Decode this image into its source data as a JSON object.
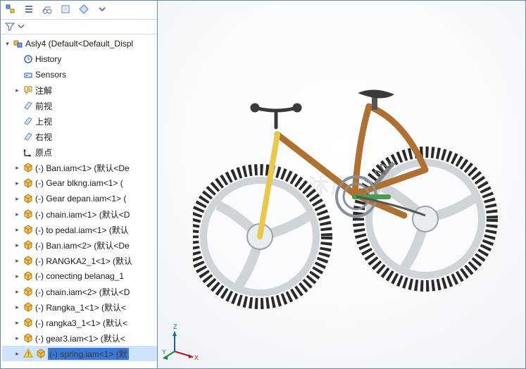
{
  "toolbar": {
    "buttons": [
      "assembly-icon",
      "list-icon",
      "motion-icon",
      "config-icon",
      "display-icon",
      "hide-icon"
    ]
  },
  "filter": {
    "tooltip": "Filter"
  },
  "tree": {
    "root": {
      "label": "Asly4  (Default<Default_Displ",
      "expand": "▾"
    },
    "items": [
      {
        "icon": "history-icon",
        "label": "History",
        "expand": ""
      },
      {
        "icon": "sensors-icon",
        "label": "Sensors",
        "expand": ""
      },
      {
        "icon": "annot-icon",
        "label": "注解",
        "expand": "▸"
      },
      {
        "icon": "plane-icon",
        "label": "前视",
        "expand": ""
      },
      {
        "icon": "plane-icon",
        "label": "上视",
        "expand": ""
      },
      {
        "icon": "plane-icon",
        "label": "右视",
        "expand": ""
      },
      {
        "icon": "origin-icon",
        "label": "原点",
        "expand": ""
      },
      {
        "icon": "part-icon",
        "label": "(-) Ban.iam<1> (默认<De",
        "expand": "▸"
      },
      {
        "icon": "part-icon",
        "label": "(-) Gear blkng.iam<1> (",
        "expand": "▸"
      },
      {
        "icon": "part-icon",
        "label": "(-) Gear depan.iam<1> (",
        "expand": "▸"
      },
      {
        "icon": "part-icon",
        "label": "(-) chain.iam<1> (默认<D",
        "expand": "▸"
      },
      {
        "icon": "part-icon",
        "label": "(-) to pedal.iam<1> (默认",
        "expand": "▸"
      },
      {
        "icon": "part-icon",
        "label": "(-) Ban.iam<2> (默认<De",
        "expand": "▸"
      },
      {
        "icon": "part-icon",
        "label": "(-) RANGKA2_1<1> (默认",
        "expand": "▸"
      },
      {
        "icon": "part-icon",
        "label": "(-) conecting belanag_1",
        "expand": "▸"
      },
      {
        "icon": "part-icon",
        "label": "(-) chain.iam<2> (默认<D",
        "expand": "▸"
      },
      {
        "icon": "part-icon",
        "label": "(-) Rangka_1<1> (默认<",
        "expand": "▸"
      },
      {
        "icon": "part-icon",
        "label": "(-) rangka3_1<1> (默认<",
        "expand": "▸"
      },
      {
        "icon": "part-icon",
        "label": "(-) gear3.iam<1> (默认<",
        "expand": "▸"
      },
      {
        "icon": "warn-icon",
        "label": "(-) spring.iam<1> (默",
        "expand": "▸",
        "warn": true,
        "selected": true
      }
    ]
  },
  "viewport": {
    "watermark": "沐风网",
    "triad": {
      "x": "X",
      "y": "Y",
      "z": "Z"
    }
  },
  "colors": {
    "frame": "#b07030",
    "fork": "#e9c94a",
    "wheel": "#9aa3ab",
    "tire": "#2a2a2a",
    "crank": "#4a9a52",
    "seat": "#3a3a3a"
  }
}
